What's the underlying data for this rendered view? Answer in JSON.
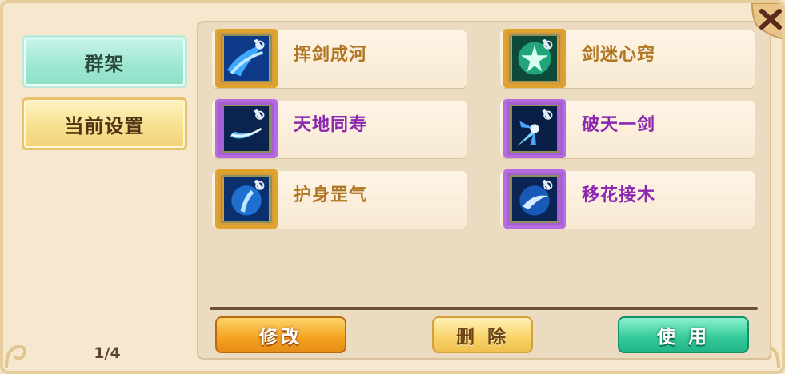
{
  "tabs": [
    {
      "label": "群架"
    },
    {
      "label": "当前设置"
    }
  ],
  "page_indicator": "1/4",
  "skills": [
    {
      "name": "挥剑成河",
      "frame": "gold",
      "icon": "blue-sword-wave-icon"
    },
    {
      "name": "剑迷心窍",
      "frame": "gold",
      "icon": "green-starburst-icon"
    },
    {
      "name": "天地同寿",
      "frame": "purple",
      "icon": "blue-crescent-slash-icon"
    },
    {
      "name": "破天一剑",
      "frame": "purple",
      "icon": "blue-sword-burst-icon"
    },
    {
      "name": "护身罡气",
      "frame": "gold",
      "icon": "blue-shield-aura-icon"
    },
    {
      "name": "移花接木",
      "frame": "purple",
      "icon": "blue-swirl-icon"
    }
  ],
  "buttons": {
    "modify": "修改",
    "delete": "删 除",
    "use": "使 用"
  },
  "colors": {
    "gold_name": "#b07622",
    "purple_name": "#8b27b0",
    "modify_button": "#f4a220",
    "use_button": "#32c999"
  }
}
